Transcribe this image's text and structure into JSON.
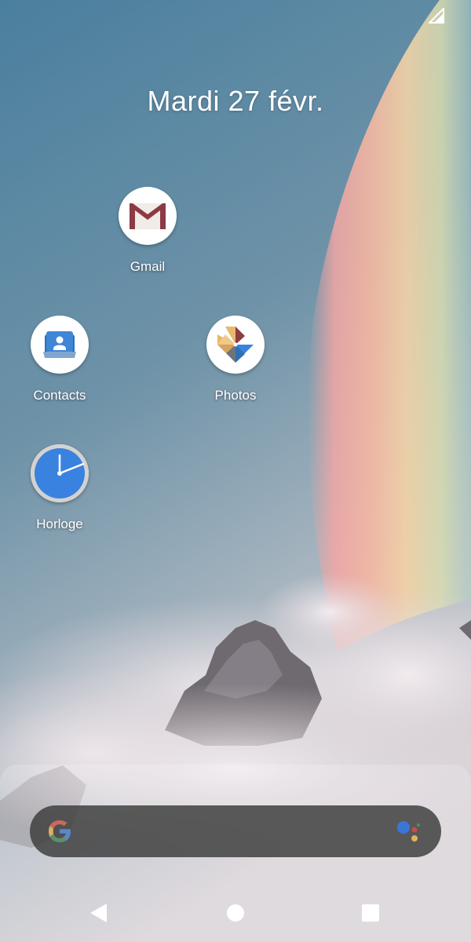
{
  "status_bar": {
    "signal_icon": "cell-signal-icon"
  },
  "home": {
    "date": "Mardi 27 févr."
  },
  "apps": [
    {
      "label": "Gmail",
      "icon": "gmail-icon"
    },
    {
      "label": "Contacts",
      "icon": "contacts-icon"
    },
    {
      "label": "Photos",
      "icon": "photos-icon"
    },
    {
      "label": "Horloge",
      "icon": "clock-icon"
    }
  ],
  "search": {
    "left_icon": "google-g-icon",
    "right_icon": "google-assistant-icon"
  },
  "nav": {
    "back_icon": "back-triangle-icon",
    "home_icon": "home-circle-icon",
    "recents_icon": "recents-square-icon"
  },
  "colors": {
    "sky_top": "#4e7f9c",
    "clouds": "#dcd3d8",
    "search_bar": "#3a3a3a",
    "clock_face": "#3a82df",
    "gmail_red": "#8d3a45"
  }
}
